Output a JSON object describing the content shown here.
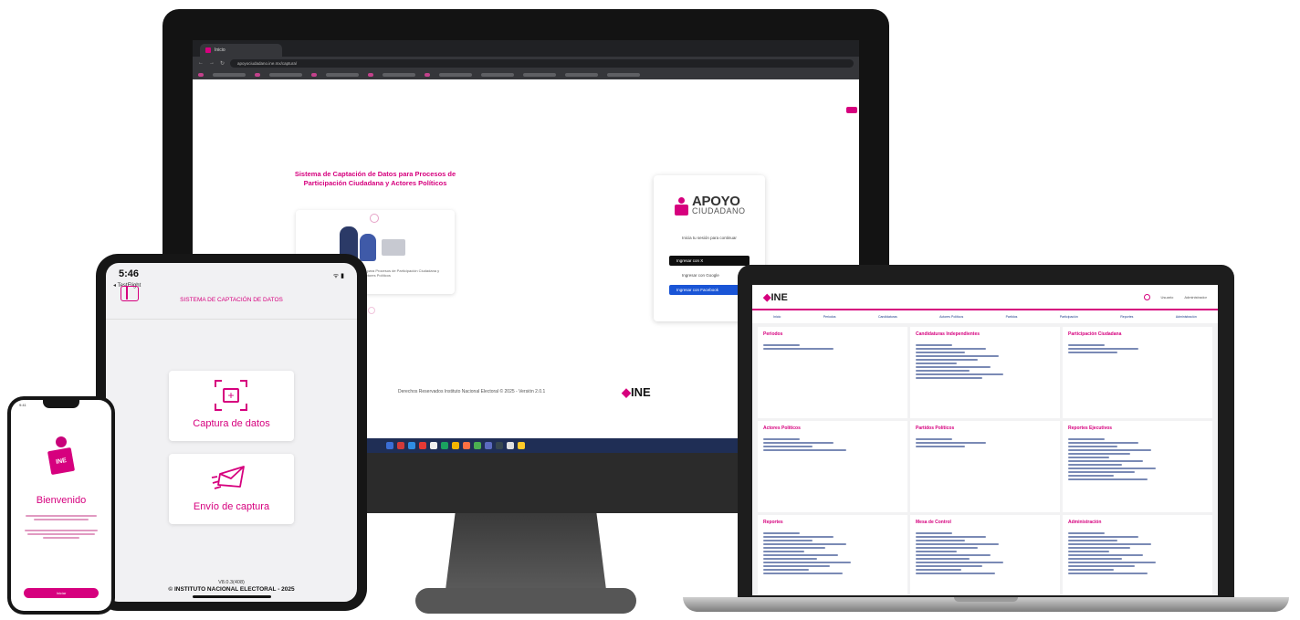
{
  "monitor": {
    "browser_tab": "Inicio",
    "browser_url": "apoyociudadano.ine.mx/captura/",
    "site_title": "Sistema de Captación de Datos para Procesos de Participación Ciudadana y Actores Políticos",
    "illustration_caption": "Sistema de Captación de Datos para Procesos de Participación Ciudadana y Actores Políticos",
    "login": {
      "logo_line1": "APOYO",
      "logo_line2": "CIUDADANO",
      "subtitle": "Inicia tu sesión para continuar",
      "btn_primary": "Ingresar con X",
      "btn_google": "Ingresar con Google",
      "btn_blue": "Ingresar con Facebook"
    },
    "footer": "Derechos Reservados Instituto Nacional Electoral © 2025 - Versión 2.0.1",
    "logo": "INE"
  },
  "laptop": {
    "logo": "INE",
    "user_label": "Usuario",
    "user_menu": "Administrador",
    "nav": [
      "Inicio",
      "Periodos",
      "Candidaturas",
      "Actores Políticos",
      "Partidos",
      "Participación",
      "Reportes",
      "Administración"
    ],
    "cards": [
      {
        "title": "Periodos",
        "lines": 2
      },
      {
        "title": "Candidaturas Independientes",
        "lines": 10
      },
      {
        "title": "Participación Ciudadana",
        "lines": 3
      },
      {
        "title": "Actores Políticos",
        "lines": 4
      },
      {
        "title": "Partidos Políticos",
        "lines": 3
      },
      {
        "title": "Reportes Ejecutivos",
        "lines": 12
      },
      {
        "title": "Reportes",
        "lines": 12
      },
      {
        "title": "Mesa de Control",
        "lines": 12
      },
      {
        "title": "Administración",
        "lines": 12
      }
    ]
  },
  "tablet": {
    "time": "5:46",
    "back_label": "◂ TestFlight",
    "header_title": "SISTEMA DE CAPTACIÓN DE DATOS",
    "card_capture": "Captura de datos",
    "card_send": "Envío de captura",
    "footer_version": "V8.0.3(408)",
    "footer_copyright": "© INSTITUTO NACIONAL ELECTORAL - 2025"
  },
  "phone": {
    "time": "9:41",
    "welcome": "Bienvenido",
    "button": "Iniciar"
  }
}
